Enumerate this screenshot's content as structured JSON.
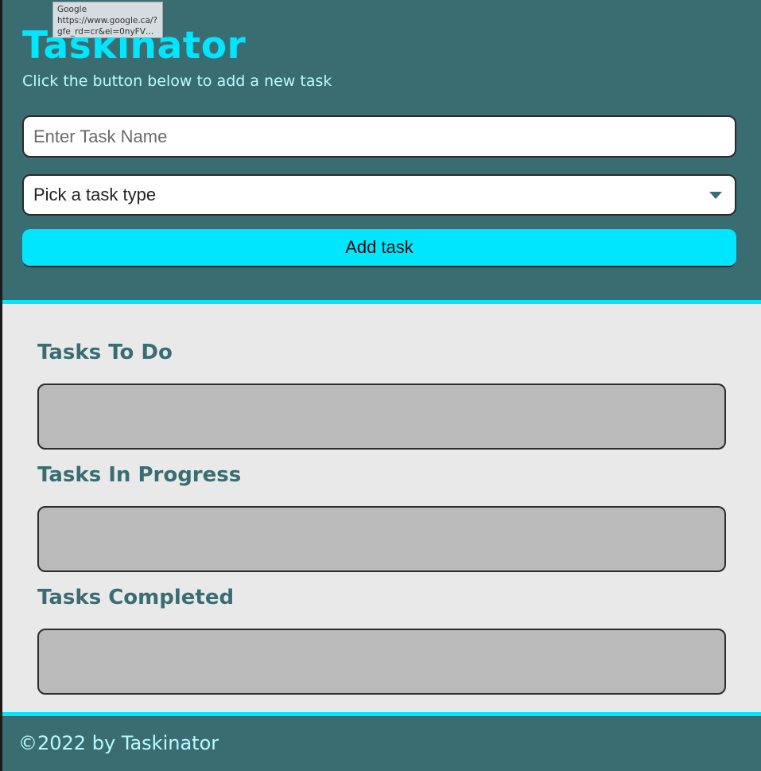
{
  "tooltip": {
    "line1": "Google",
    "line2": "https://www.google.ca/?",
    "line3": "gfe_rd=cr&ei=0nyFV9..."
  },
  "header": {
    "title": "Taskinator",
    "subtitle": "Click the button below to add a new task"
  },
  "form": {
    "task_name_placeholder": "Enter Task Name",
    "task_name_value": "",
    "task_type_selected": "Pick a task type",
    "add_button_label": "Add task"
  },
  "sections": [
    {
      "title": "Tasks To Do"
    },
    {
      "title": "Tasks In Progress"
    },
    {
      "title": "Tasks Completed"
    }
  ],
  "footer": {
    "text": "©2022 by Taskinator"
  },
  "colors": {
    "header_bg": "#3a6d72",
    "accent": "#00e6ff",
    "subtitle": "#b9fbff",
    "main_bg": "#e9e9e9",
    "task_list_bg": "#bababa"
  }
}
